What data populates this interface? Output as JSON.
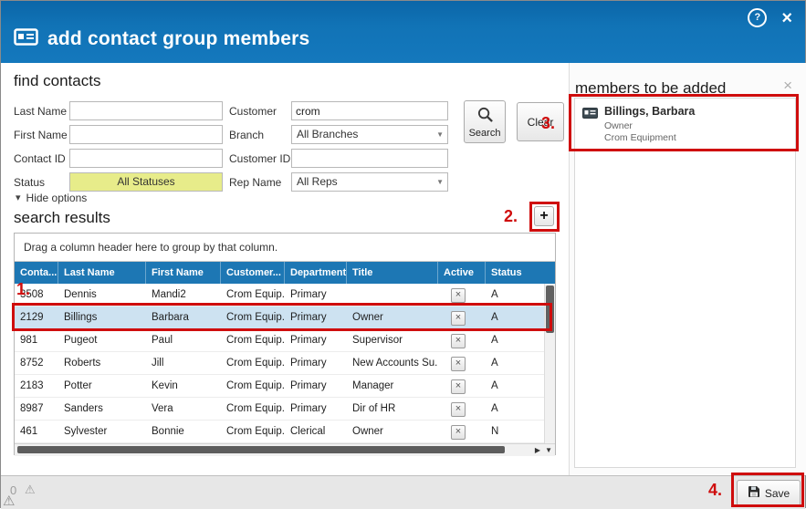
{
  "colors": {
    "header_blue": "#1173b6",
    "grid_header_blue": "#1d77b4",
    "selected_row": "#cde2f1",
    "status_yellow": "#e7ec8a",
    "annotation_red": "#cf0d0d"
  },
  "icons": {
    "help": "?",
    "close": "×",
    "dropdown_arrow": "▼",
    "hide_chevron": "▾",
    "add": "+",
    "row_action": "×",
    "clear_members": "×",
    "warning": "⚠",
    "scroll_right": "▶",
    "scroll_down": "▼"
  },
  "header": {
    "title": "add contact group members"
  },
  "find": {
    "section_title": "find contacts",
    "labels": {
      "last_name": "Last Name",
      "first_name": "First Name",
      "contact_id": "Contact ID",
      "status": "Status",
      "customer": "Customer",
      "branch": "Branch",
      "customer_id": "Customer ID",
      "rep_name": "Rep Name"
    },
    "values": {
      "last_name": "",
      "first_name": "",
      "contact_id": "",
      "status": "All Statuses",
      "customer": "crom",
      "branch": "All Branches",
      "customer_id": "",
      "rep_name": "All Reps"
    },
    "search_label": "Search",
    "clear_label": "Clear",
    "hide_options": "Hide options"
  },
  "results": {
    "section_title": "search results",
    "group_hint": "Drag a column header here to group by that column.",
    "columns": [
      "Conta...",
      "Last Name",
      "First Name",
      "Customer...",
      "Department",
      "Title",
      "Active",
      "Status"
    ],
    "rows": [
      {
        "id": "3508",
        "last": "Dennis",
        "first": "Mandi2",
        "customer": "Crom Equip...",
        "dept": "Primary",
        "title": "",
        "status": "A"
      },
      {
        "id": "2129",
        "last": "Billings",
        "first": "Barbara",
        "customer": "Crom Equip...",
        "dept": "Primary",
        "title": "Owner",
        "status": "A"
      },
      {
        "id": "981",
        "last": "Pugeot",
        "first": "Paul",
        "customer": "Crom Equip...",
        "dept": "Primary",
        "title": "Supervisor",
        "status": "A"
      },
      {
        "id": "8752",
        "last": "Roberts",
        "first": "Jill",
        "customer": "Crom Equip...",
        "dept": "Primary",
        "title": "New Accounts Su...",
        "status": "A"
      },
      {
        "id": "2183",
        "last": "Potter",
        "first": "Kevin",
        "customer": "Crom Equip...",
        "dept": "Primary",
        "title": "Manager",
        "status": "A"
      },
      {
        "id": "8987",
        "last": "Sanders",
        "first": "Vera",
        "customer": "Crom Equip...",
        "dept": "Primary",
        "title": "Dir of HR",
        "status": "A"
      },
      {
        "id": "461",
        "last": "Sylvester",
        "first": "Bonnie",
        "customer": "Crom Equip...",
        "dept": "Clerical",
        "title": "Owner",
        "status": "N"
      }
    ]
  },
  "members": {
    "section_title": "members to be added",
    "items": [
      {
        "name": "Billings, Barbara",
        "title": "Owner",
        "company": "Crom Equipment"
      }
    ]
  },
  "footer": {
    "count": "0",
    "save": "Save"
  },
  "annotations": {
    "n1": "1.",
    "n2": "2.",
    "n3": "3.",
    "n4": "4."
  }
}
